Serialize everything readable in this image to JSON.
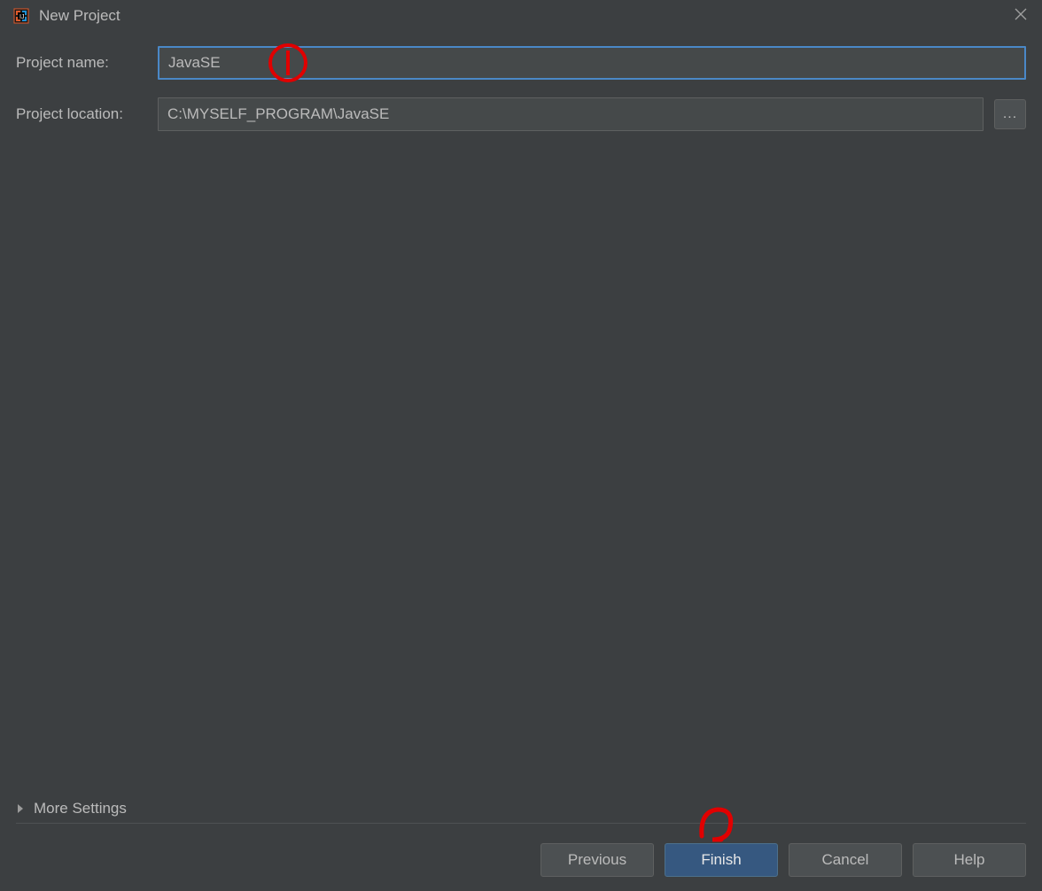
{
  "window": {
    "title": "New Project"
  },
  "form": {
    "project_name_label": "Project name:",
    "project_name_value": "JavaSE",
    "project_location_label": "Project location:",
    "project_location_value": "C:\\MYSELF_PROGRAM\\JavaSE",
    "browse_label": "..."
  },
  "more_settings": {
    "label": "More Settings"
  },
  "buttons": {
    "previous": "Previous",
    "finish": "Finish",
    "cancel": "Cancel",
    "help": "Help"
  },
  "annotations": {
    "marker1": "1",
    "marker2": "2"
  }
}
